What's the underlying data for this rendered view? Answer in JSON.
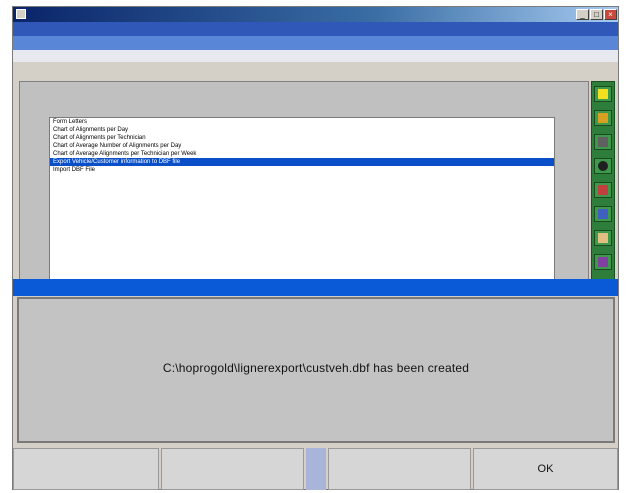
{
  "window": {
    "title": "",
    "subtitle1": "",
    "subtitle2": ""
  },
  "list": {
    "items": [
      {
        "label": "Form Letters",
        "selected": false
      },
      {
        "label": "Chart of Alignments per Day",
        "selected": false
      },
      {
        "label": "Chart of Alignments per Technician",
        "selected": false
      },
      {
        "label": "Chart of Average Number of Alignments per Day",
        "selected": false
      },
      {
        "label": "Chart of Average Alignments per Technician per Week",
        "selected": false
      },
      {
        "label": "Export Vehicle/Customer information to DBF file",
        "selected": true
      },
      {
        "label": "Import DBF File",
        "selected": false
      }
    ]
  },
  "toolbar": {
    "icons": [
      "help-icon",
      "folder-icon",
      "wrench-icon",
      "tire-icon",
      "car-icon",
      "tool-icon",
      "person-icon",
      "back-icon"
    ]
  },
  "message": {
    "text": "C:\\hoprogold\\lignerexport\\custveh.dbf has been created"
  },
  "buttons": {
    "b1": "",
    "b2": "",
    "b3": "",
    "ok": "OK"
  },
  "colors": {
    "selection": "#0a4fc8",
    "title_gradient_start": "#0a246a",
    "message_bg": "#c3c3c3",
    "toolbar": "#2e7d3a"
  }
}
